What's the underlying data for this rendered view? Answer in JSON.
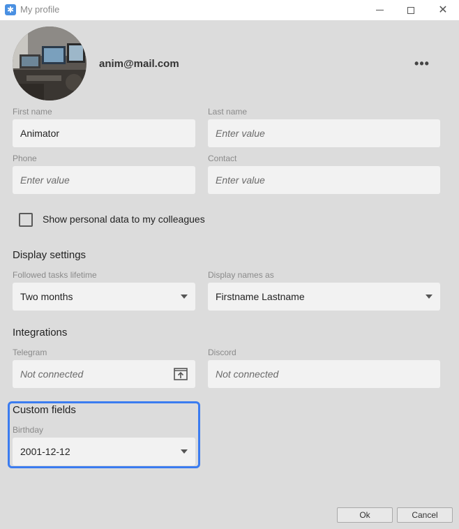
{
  "window": {
    "title": "My profile",
    "icon": "snowflake-app-icon",
    "close_glyph": "✕"
  },
  "profile": {
    "email": "anim@mail.com",
    "more_label": "•••"
  },
  "fields": {
    "first_name": {
      "label": "First name",
      "value": "Animator"
    },
    "last_name": {
      "label": "Last name",
      "placeholder": "Enter value"
    },
    "phone": {
      "label": "Phone",
      "placeholder": "Enter value"
    },
    "contact": {
      "label": "Contact",
      "placeholder": "Enter value"
    }
  },
  "privacy": {
    "show_personal_data_label": "Show personal data to my colleagues",
    "checked": false
  },
  "display_settings": {
    "title": "Display settings",
    "followed_tasks_lifetime": {
      "label": "Followed tasks lifetime",
      "value": "Two months"
    },
    "display_names_as": {
      "label": "Display names as",
      "value": "Firstname Lastname"
    }
  },
  "integrations": {
    "title": "Integrations",
    "telegram": {
      "label": "Telegram",
      "value": "Not connected"
    },
    "discord": {
      "label": "Discord",
      "value": "Not connected"
    }
  },
  "custom_fields": {
    "title": "Custom fields",
    "birthday": {
      "label": "Birthday",
      "value": "2001-12-12"
    }
  },
  "buttons": {
    "ok": "Ok",
    "cancel": "Cancel"
  },
  "colors": {
    "accent": "#3b7cf0",
    "background": "#dcdcdc",
    "field_bg": "#f2f2f2"
  }
}
